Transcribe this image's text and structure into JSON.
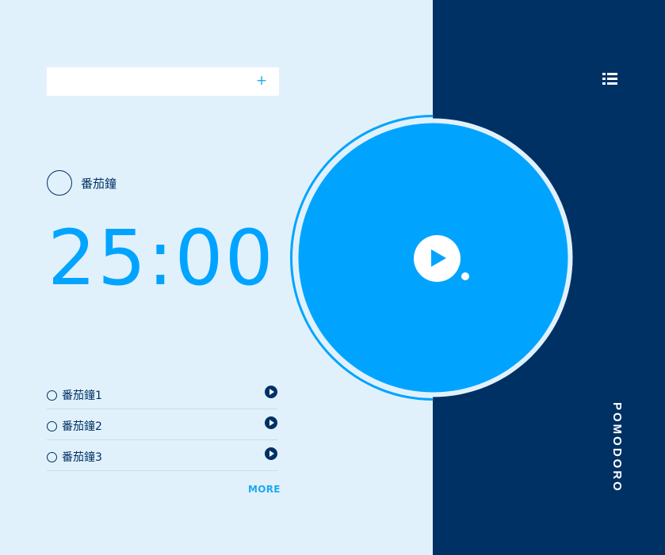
{
  "add_task": {
    "placeholder": "",
    "add_icon": "plus-icon",
    "add_symbol": "+"
  },
  "current_task": {
    "label": "番茄鐘"
  },
  "timer": {
    "display": "25:00"
  },
  "tasks": [
    {
      "label": "番茄鐘1"
    },
    {
      "label": "番茄鐘2"
    },
    {
      "label": "番茄鐘3"
    }
  ],
  "more_label": "MORE",
  "brand": "POMODORO",
  "icons": {
    "menu": "list-icon",
    "play": "play-icon"
  },
  "colors": {
    "left_background": "#e1f1fc",
    "right_background": "#003164",
    "accent": "#00a4ff",
    "text_dark": "#003164",
    "link": "#1fa8f0"
  }
}
